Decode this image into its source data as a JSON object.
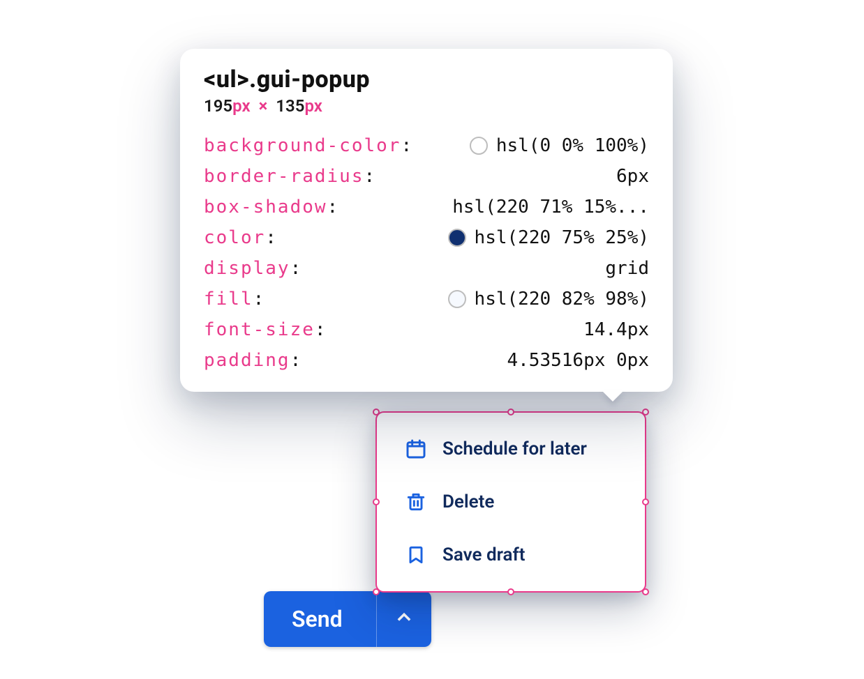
{
  "send_button": {
    "label": "Send"
  },
  "popup": {
    "items": [
      {
        "icon": "calendar-icon",
        "label": "Schedule for later"
      },
      {
        "icon": "trash-icon",
        "label": "Delete"
      },
      {
        "icon": "bookmark-icon",
        "label": "Save draft"
      }
    ]
  },
  "tooltip": {
    "selector_tag": "<ul>",
    "selector_class": ".gui-popup",
    "width_num": "195",
    "height_num": "135",
    "px_unit": "px",
    "times": "×",
    "props": [
      {
        "name": "background-color",
        "value": "hsl(0 0% 100%)",
        "swatch": "hsl(0 0% 100%)"
      },
      {
        "name": "border-radius",
        "value": "6px"
      },
      {
        "name": "box-shadow",
        "value": "hsl(220 71% 15%..."
      },
      {
        "name": "color",
        "value": "hsl(220 75% 25%)",
        "swatch": "hsl(220 75% 25%)"
      },
      {
        "name": "display",
        "value": "grid"
      },
      {
        "name": "fill",
        "value": "hsl(220 82% 98%)",
        "swatch": "hsl(220 82% 98%)"
      },
      {
        "name": "font-size",
        "value": "14.4px"
      },
      {
        "name": "padding",
        "value": "4.53516px 0px"
      }
    ]
  }
}
